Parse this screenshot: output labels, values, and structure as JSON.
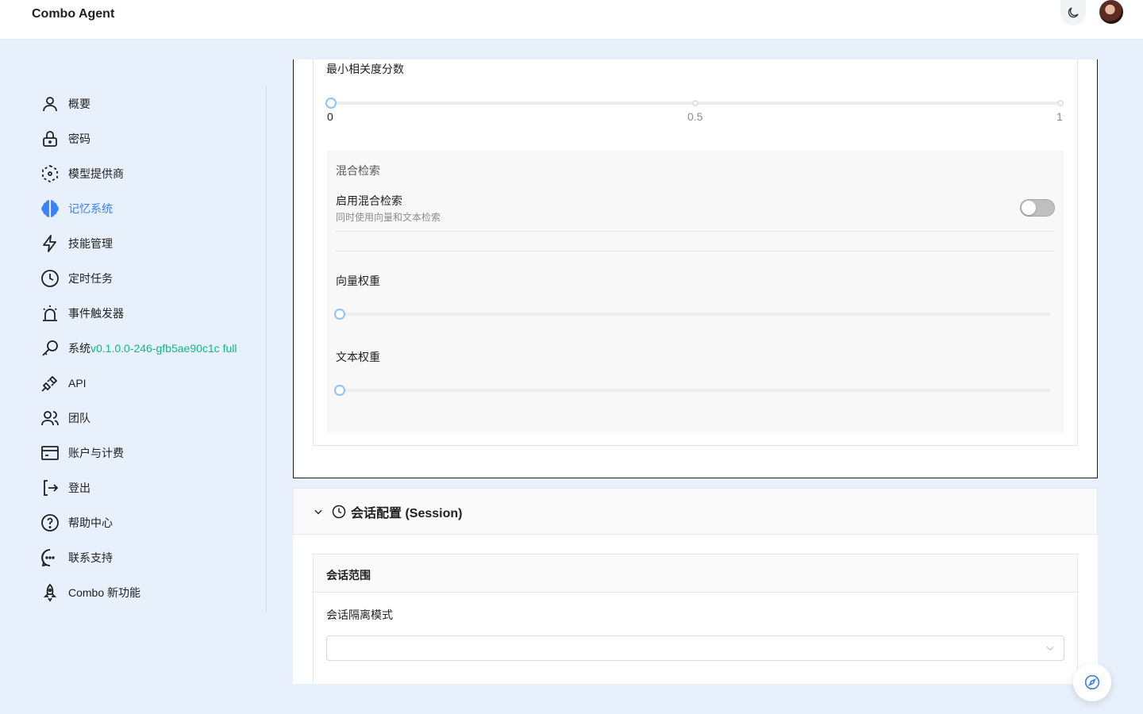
{
  "app": {
    "title": "Combo Agent"
  },
  "sidebar": {
    "items": [
      {
        "label": "概要",
        "icon": "user-icon"
      },
      {
        "label": "密码",
        "icon": "lock-icon"
      },
      {
        "label": "模型提供商",
        "icon": "cube-icon"
      },
      {
        "label": "记忆系统",
        "icon": "brain-icon",
        "active": true
      },
      {
        "label": "技能管理",
        "icon": "lightning-icon"
      },
      {
        "label": "定时任务",
        "icon": "clock-icon"
      },
      {
        "label": "事件触发器",
        "icon": "alarm-icon"
      },
      {
        "label": "系统",
        "version": "v0.1.0.0-246-gfb5ae90c1c full",
        "icon": "key-icon"
      },
      {
        "label": "API",
        "icon": "plug-icon"
      },
      {
        "label": "团队",
        "icon": "users-icon"
      },
      {
        "label": "账户与计费",
        "icon": "credit-card-icon"
      },
      {
        "label": "登出",
        "icon": "logout-icon"
      },
      {
        "label": "帮助中心",
        "icon": "help-icon"
      },
      {
        "label": "联系支持",
        "icon": "chat-icon"
      },
      {
        "label": "Combo 新功能",
        "icon": "rocket-icon"
      }
    ]
  },
  "memory": {
    "min_score": {
      "label": "最小相关度分数",
      "value": 0,
      "ticks": [
        "0",
        "0.5",
        "1"
      ]
    },
    "hybrid": {
      "section_title": "混合检索",
      "enable_label": "启用混合检索",
      "enable_desc": "同时使用向量和文本检索",
      "enabled": false,
      "vector_weight_label": "向量权重",
      "vector_weight": 0,
      "text_weight_label": "文本权重",
      "text_weight": 0
    }
  },
  "session": {
    "header_title": "会话配置 (Session)",
    "scope_title": "会话范围",
    "isolation_label": "会话隔离模式",
    "isolation_value": ""
  },
  "colors": {
    "accent": "#3b82f6",
    "version": "#10b981",
    "background": "#e8f0fb"
  }
}
